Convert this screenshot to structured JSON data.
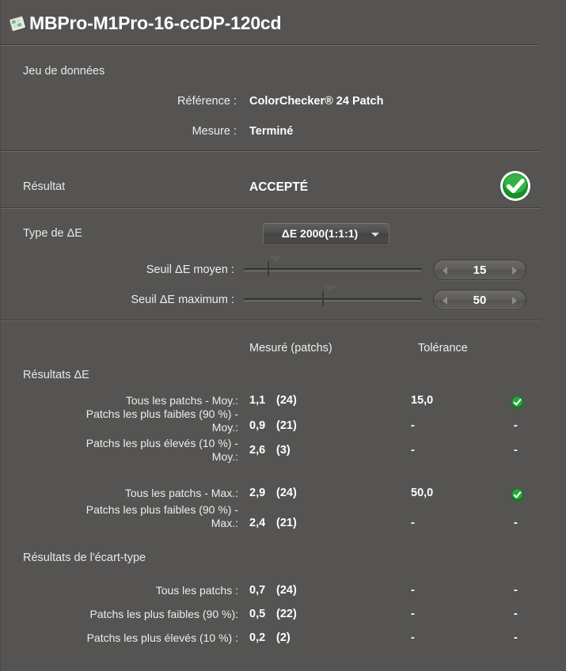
{
  "window": {
    "title": "MBPro-M1Pro-16-ccDP-120cd",
    "title_icon": "document-measurement-icon"
  },
  "dataset": {
    "section_label": "Jeu de données",
    "reference_label": "Référence :",
    "reference_value": "ColorChecker® 24 Patch",
    "measure_label": "Mesure :",
    "measure_value": "Terminé"
  },
  "result": {
    "label": "Résultat",
    "value": "ACCEPTÉ",
    "badge_icon": "green-check-badge-icon",
    "badge_color": "#1e9e2e"
  },
  "settings": {
    "de_type_label": "Type de ΔE",
    "de_type_value": "ΔE 2000(1:1:1)",
    "mean_threshold_label": "Seuil ΔE moyen :",
    "mean_threshold_value": "15",
    "mean_threshold_percent": 13,
    "max_threshold_label": "Seuil ΔE maximum :",
    "max_threshold_value": "50",
    "max_threshold_percent": 48
  },
  "table": {
    "col_measured": "Mesuré (patchs)",
    "col_tolerance": "Tolérance",
    "group_de": "Résultats ΔE",
    "group_stddev": "Résultats de l'écart-type",
    "rows_de": [
      {
        "label": "Tous les patchs - Moy.:",
        "label_line2": "",
        "value": "1,1",
        "count": "(24)",
        "tolerance": "15,0",
        "status": "pass",
        "status_icon": "green-check-mini-icon"
      },
      {
        "label": "Patchs les plus faibles (90 %) -",
        "label_line2": "Moy.:",
        "value": "0,9",
        "count": "(21)",
        "tolerance": "-",
        "status": "none",
        "status_icon": "dash"
      },
      {
        "label": "Patchs les plus élevés (10 %) -",
        "label_line2": "Moy.:",
        "value": "2,6",
        "count": "(3)",
        "tolerance": "-",
        "status": "none",
        "status_icon": "dash"
      },
      {
        "label": "Tous les patchs - Max.:",
        "label_line2": "",
        "value": "2,9",
        "count": "(24)",
        "tolerance": "50,0",
        "status": "pass",
        "status_icon": "green-check-mini-icon"
      },
      {
        "label": "Patchs les plus faibles (90 %) -",
        "label_line2": "Max.:",
        "value": "2,4",
        "count": "(21)",
        "tolerance": "-",
        "status": "none",
        "status_icon": "dash"
      }
    ],
    "rows_stddev": [
      {
        "label": "Tous les patchs :",
        "value": "0,7",
        "count": "(24)",
        "tolerance": "-",
        "status": "none",
        "status_icon": "dash"
      },
      {
        "label": "Patchs les plus faibles (90 %):",
        "value": "0,5",
        "count": "(22)",
        "tolerance": "-",
        "status": "none",
        "status_icon": "dash"
      },
      {
        "label": "Patchs les plus élevés (10 %) :",
        "value": "0,2",
        "count": "(2)",
        "tolerance": "-",
        "status": "none",
        "status_icon": "dash"
      }
    ]
  },
  "colors": {
    "background": "#555452",
    "separator_dark": "#403f3e",
    "separator_light": "#6d6c6a",
    "text": "#ededed",
    "accent_green": "#1e9e2e"
  }
}
